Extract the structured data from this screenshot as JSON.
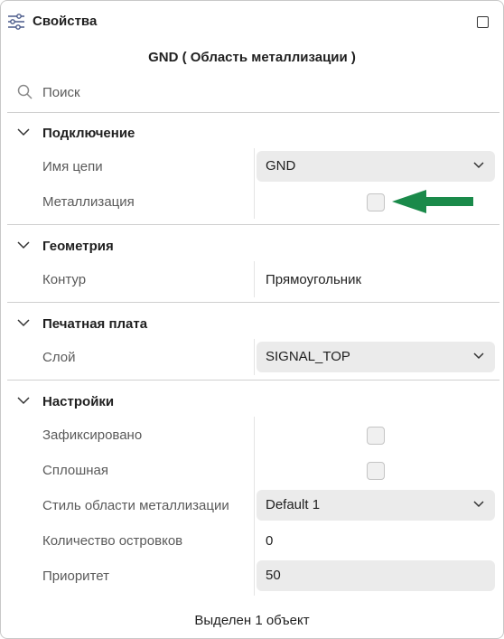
{
  "header": {
    "title": "Свойства",
    "icon": "sliders-icon"
  },
  "object_title": "GND ( Область металлизации )",
  "search": {
    "placeholder": "Поиск"
  },
  "sections": {
    "connection": {
      "label": "Подключение",
      "net_name": {
        "label": "Имя цепи",
        "value": "GND"
      },
      "metallization": {
        "label": "Металлизация",
        "checked": false
      }
    },
    "geometry": {
      "label": "Геометрия",
      "contour": {
        "label": "Контур",
        "value": "Прямоугольник"
      }
    },
    "pcb": {
      "label": "Печатная плата",
      "layer": {
        "label": "Слой",
        "value": "SIGNAL_TOP"
      }
    },
    "settings": {
      "label": "Настройки",
      "fixed": {
        "label": "Зафиксировано",
        "checked": false
      },
      "solid": {
        "label": "Сплошная",
        "checked": false
      },
      "style": {
        "label": "Стиль области металлизации",
        "value": "Default 1"
      },
      "islands": {
        "label": "Количество островков",
        "value": "0"
      },
      "priority": {
        "label": "Приоритет",
        "value": "50"
      }
    }
  },
  "footer": "Выделен 1 объект",
  "colors": {
    "arrow": "#1a8a4a",
    "field_bg": "#ebebeb",
    "divider": "#cfcfcf"
  }
}
